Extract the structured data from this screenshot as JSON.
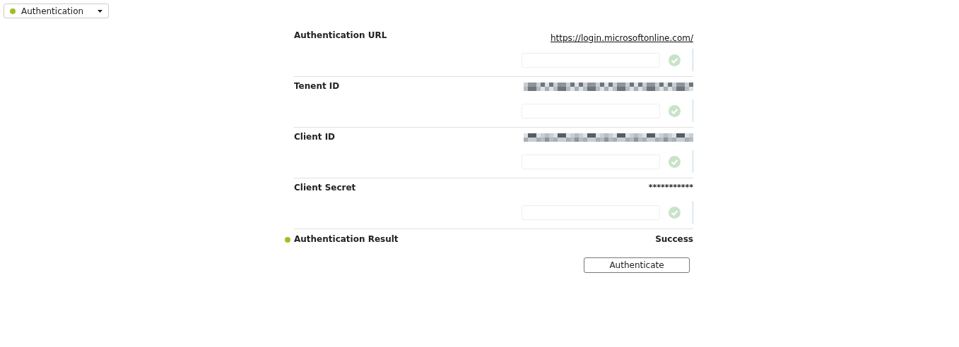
{
  "section_selector": {
    "label": "Authentication",
    "color": "#9dc02b"
  },
  "fields": [
    {
      "label": "Authentication URL",
      "kind": "link",
      "value": "https://login.microsoftonline.com/",
      "valid": true
    },
    {
      "label": "Tenent ID",
      "kind": "redacted",
      "valid": true
    },
    {
      "label": "Client ID",
      "kind": "redacted",
      "valid": true
    },
    {
      "label": "Client Secret",
      "kind": "text",
      "value": "***********",
      "valid": true
    }
  ],
  "result": {
    "label": "Authentication Result",
    "value": "Success",
    "color": "#9dc02b"
  },
  "button": "Authenticate"
}
